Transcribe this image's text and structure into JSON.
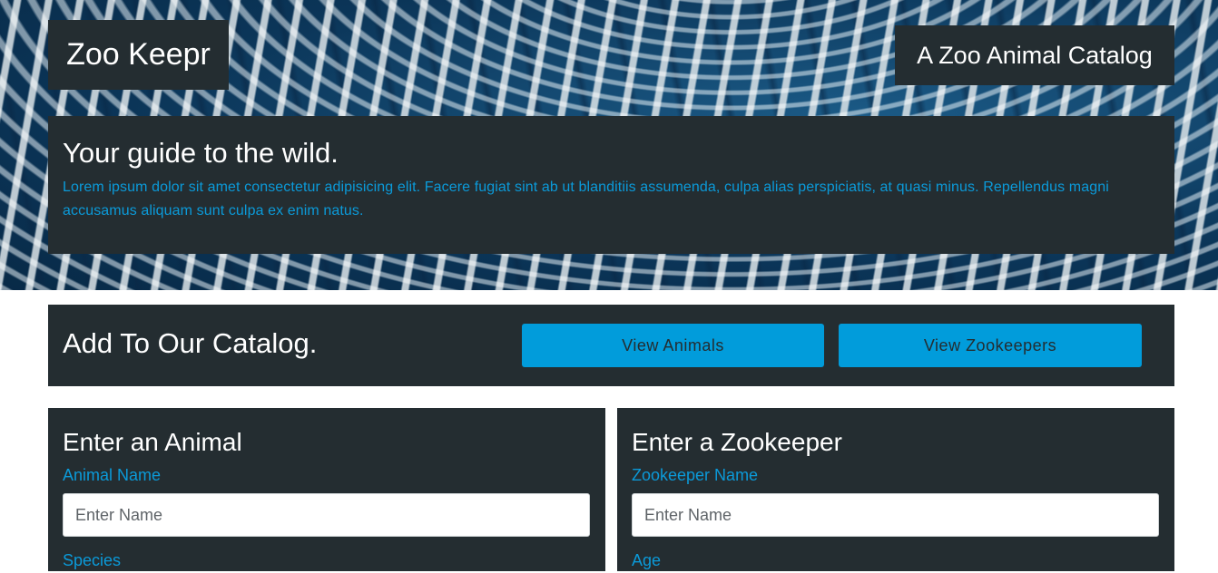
{
  "header": {
    "site_title": "Zoo Keepr",
    "tagline": "A Zoo Animal Catalog"
  },
  "intro": {
    "heading": "Your guide to the wild.",
    "text": "Lorem ipsum dolor sit amet consectetur adipisicing elit. Facere fugiat sint ab ut blanditiis assumenda, culpa alias perspiciatis, at quasi minus. Repellendus magni accusamus aliquam sunt culpa ex enim natus."
  },
  "catalog": {
    "title": "Add To Our Catalog.",
    "view_animals_label": "View Animals",
    "view_zookeepers_label": "View Zookeepers"
  },
  "animal_form": {
    "title": "Enter an Animal",
    "name_label": "Animal Name",
    "name_placeholder": "Enter Name",
    "second_label": "Species"
  },
  "zookeeper_form": {
    "title": "Enter a Zookeeper",
    "name_label": "Zookeeper Name",
    "name_placeholder": "Enter Name",
    "second_label": "Age"
  },
  "colors": {
    "panel": "#242d31",
    "accent": "#019cdb",
    "accent_text": "#0b9ad9"
  }
}
